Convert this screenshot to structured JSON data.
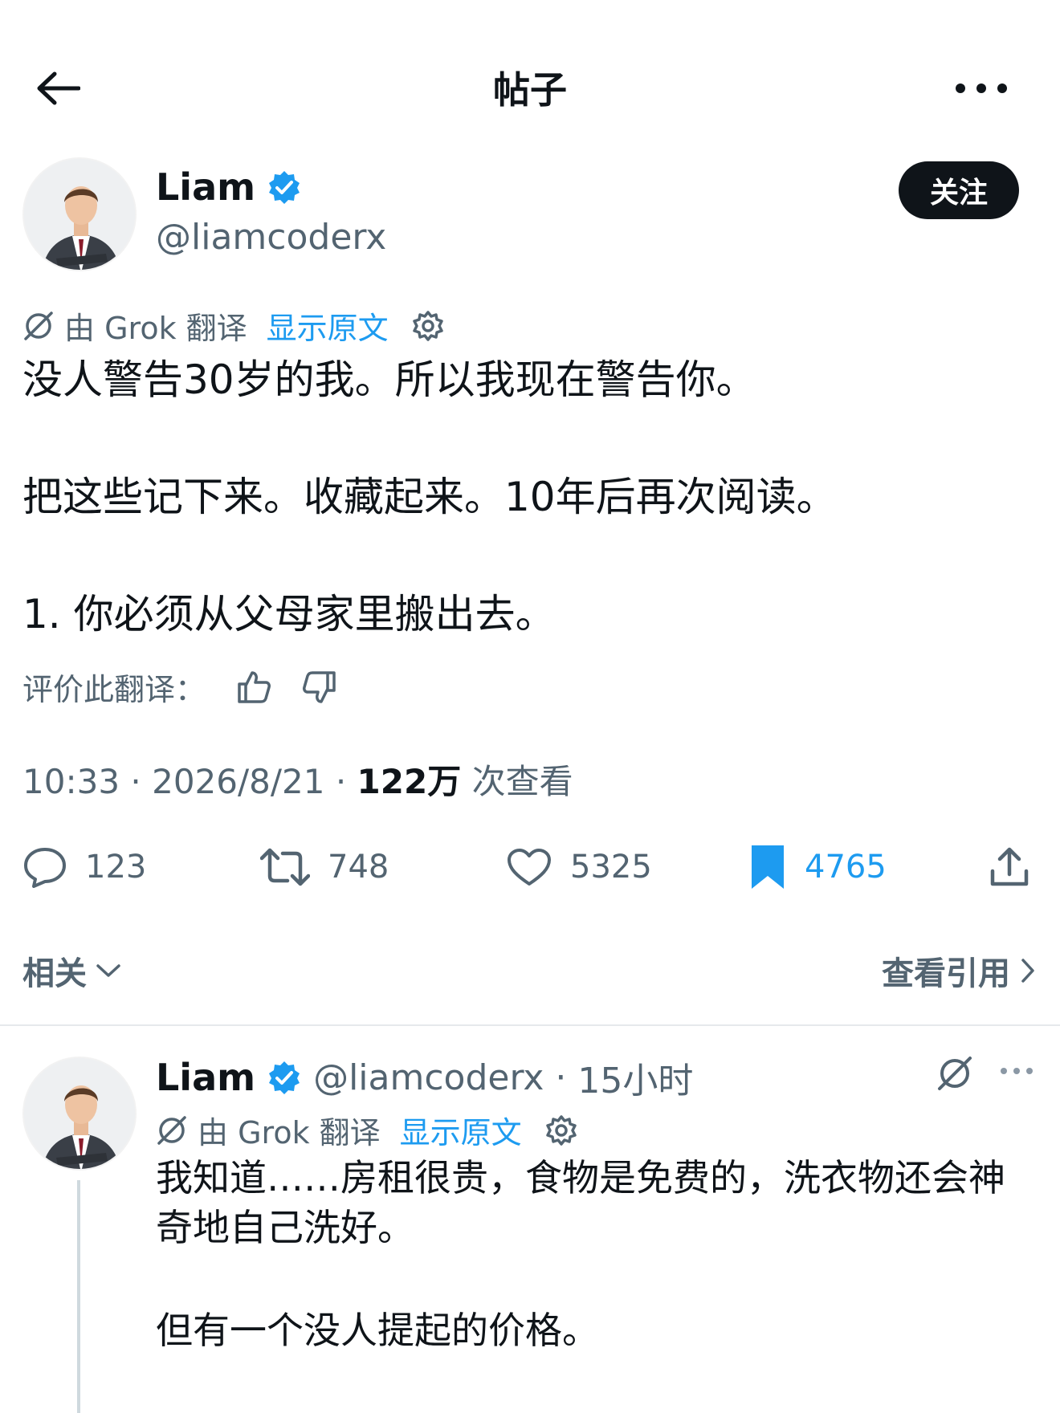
{
  "header": {
    "title": "帖子"
  },
  "post": {
    "author_name": "Liam",
    "author_handle": "@liamcoderx",
    "follow_label": "关注",
    "translation": {
      "by": "由 Grok 翻译",
      "show_original": "显示原文"
    },
    "body": [
      "没人警告30岁的我。所以我现在警告你。",
      "把这些记下来。收藏起来。10年后再次阅读。",
      "1. 你必须从父母家里搬出去。"
    ],
    "rate_label": "评价此翻译：",
    "time": "10:33",
    "date": "2026/8/21",
    "views_count": "122万",
    "views_label": "次查看",
    "stats": {
      "replies": "123",
      "reposts": "748",
      "likes": "5325",
      "bookmarks": "4765"
    },
    "bookmark_color": "#1d9bf0"
  },
  "related": {
    "label": "相关",
    "quotes_label": "查看引用"
  },
  "reply": {
    "author_name": "Liam",
    "author_handle": "@liamcoderx",
    "time_ago": "15小时",
    "translation": {
      "by": "由 Grok 翻译",
      "show_original": "显示原文"
    },
    "body": [
      "我知道……房租很贵，食物是免费的，洗衣物还会神奇地自己洗好。",
      "但有一个没人提起的价格。"
    ]
  }
}
